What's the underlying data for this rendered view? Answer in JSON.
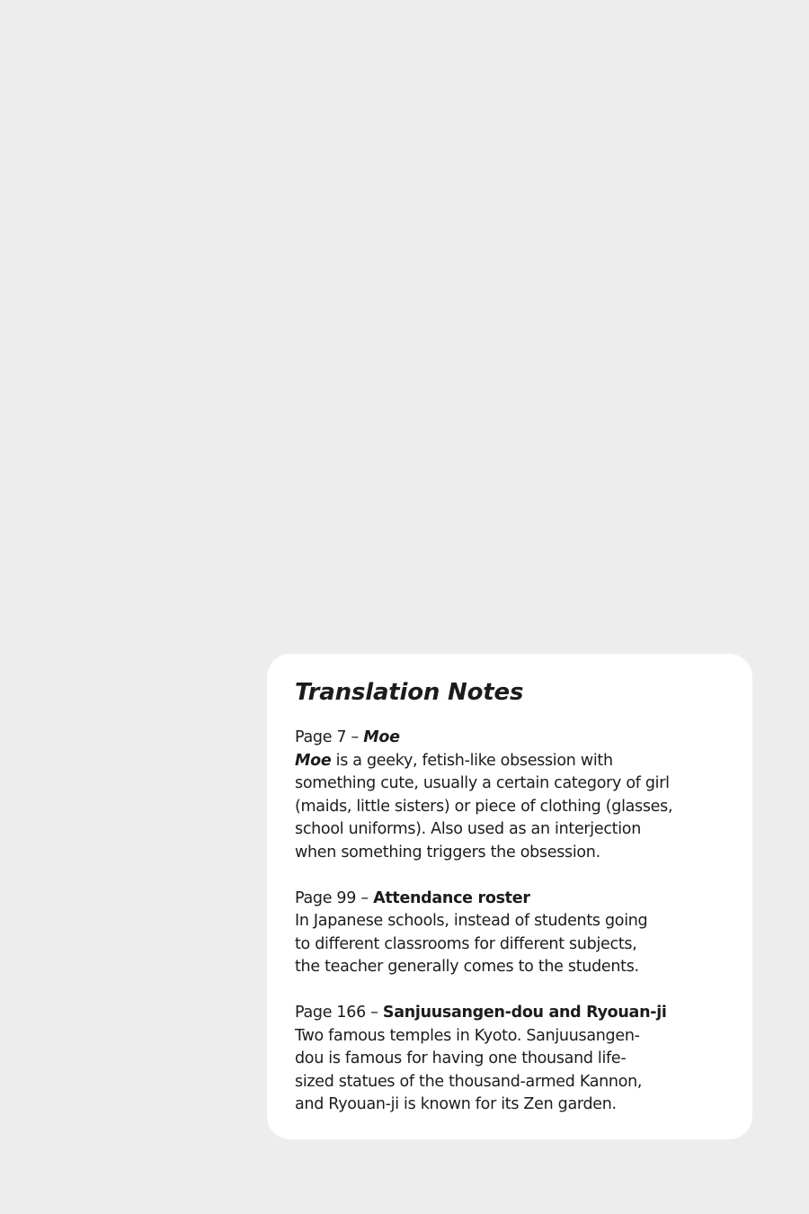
{
  "title": "Translation Notes",
  "notes": [
    {
      "page_label": "Page 7 – ",
      "term": "Moe",
      "body_term": "Moe",
      "lines": [
        " is a geeky, fetish-like obsession with",
        "something cute, usually a certain category of girl",
        "(maids, little sisters) or piece of clothing (glasses,",
        "school uniforms). Also used as an interjection",
        "when something triggers the obsession."
      ]
    },
    {
      "page_label": "Page 99 – ",
      "term": "Attendance roster",
      "lines": [
        "In Japanese schools, instead of students going",
        "to different classrooms for different subjects,",
        "the teacher generally comes to the students."
      ]
    },
    {
      "page_label": "Page 166 – ",
      "term": "Sanjuusangen-dou and Ryouan-ji",
      "lines": [
        "Two famous temples in Kyoto. Sanjuusangen-",
        "dou is famous for having one thousand life-",
        "sized statues of the thousand-armed Kannon,",
        "and Ryouan-ji is known for its Zen garden."
      ]
    }
  ]
}
